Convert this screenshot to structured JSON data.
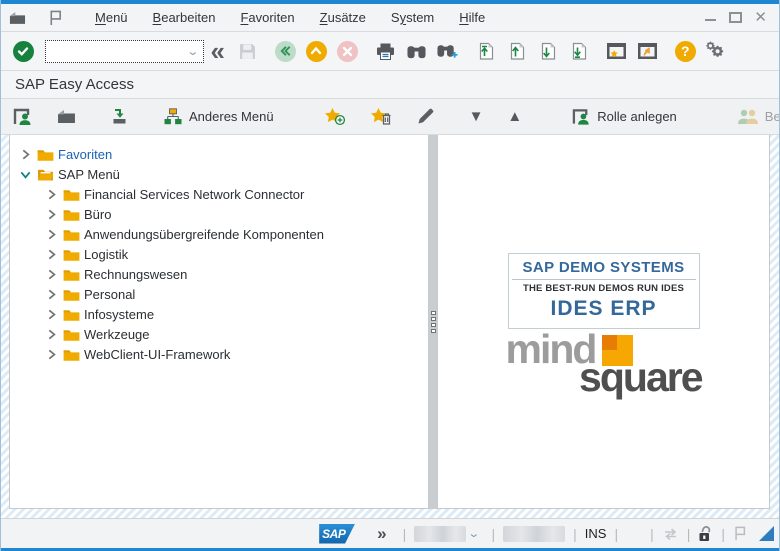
{
  "window": {
    "controls": [
      "minimize",
      "maximize",
      "close"
    ],
    "accent_color": "#1f86d2"
  },
  "titlebar": {
    "icons": [
      "sap-menu-box-icon",
      "gui-flag-icon"
    ],
    "menus": [
      {
        "label": "Menü",
        "underline_index": 0
      },
      {
        "label": "Bearbeiten",
        "underline_index": 0
      },
      {
        "label": "Favoriten",
        "underline_index": 0
      },
      {
        "label": "Zusätze",
        "underline_index": 0
      },
      {
        "label": "System",
        "underline_index": 1
      },
      {
        "label": "Hilfe",
        "underline_index": 0
      }
    ]
  },
  "toolbar": {
    "command_field": {
      "value": "",
      "placeholder": ""
    },
    "icons": [
      "enter-check-icon",
      "command-dropdown-icon",
      "collapse-chevrons-icon",
      "save-icon",
      "back-icon",
      "exit-icon",
      "cancel-icon",
      "print-icon",
      "find-icon",
      "find-next-icon",
      "first-page-icon",
      "page-up-icon",
      "page-down-icon",
      "last-page-icon",
      "new-session-icon",
      "create-shortcut-icon",
      "help-icon",
      "customize-layout-icon"
    ]
  },
  "header": {
    "title": "SAP Easy Access"
  },
  "app_toolbar": {
    "icons": [
      "user-menu-icon",
      "sap-menu-icon",
      "display-documentation-icon",
      "org-chart-icon",
      "add-favorite-icon",
      "delete-favorite-icon",
      "edit-favorite-icon",
      "move-down-icon",
      "move-up-icon",
      "create-role-icon",
      "assign-users-icon",
      "overflow-icon"
    ],
    "labels": {
      "anderes_menu": "Anderes Menü",
      "rolle_anlegen": "Rolle anlegen",
      "benutzer_zuordnen": "Benutzer zuordnen",
      "overflow": "»"
    },
    "benutzer_zuordnen_disabled": true
  },
  "tree": {
    "items": [
      {
        "label": "Favoriten",
        "level": 0,
        "state": "collapsed",
        "folder": "closed",
        "link": true
      },
      {
        "label": "SAP Menü",
        "level": 0,
        "state": "expanded",
        "folder": "open",
        "link": false
      },
      {
        "label": "Financial Services Network Connector",
        "level": 1,
        "state": "collapsed",
        "folder": "closed",
        "link": false
      },
      {
        "label": "Büro",
        "level": 1,
        "state": "collapsed",
        "folder": "closed",
        "link": false
      },
      {
        "label": "Anwendungsübergreifende Komponenten",
        "level": 1,
        "state": "collapsed",
        "folder": "closed",
        "link": false
      },
      {
        "label": "Logistik",
        "level": 1,
        "state": "collapsed",
        "folder": "closed",
        "link": false
      },
      {
        "label": "Rechnungswesen",
        "level": 1,
        "state": "collapsed",
        "folder": "closed",
        "link": false
      },
      {
        "label": "Personal",
        "level": 1,
        "state": "collapsed",
        "folder": "closed",
        "link": false
      },
      {
        "label": "Infosysteme",
        "level": 1,
        "state": "collapsed",
        "folder": "closed",
        "link": false
      },
      {
        "label": "Werkzeuge",
        "level": 1,
        "state": "collapsed",
        "folder": "closed",
        "link": false
      },
      {
        "label": "WebClient-UI-Framework",
        "level": 1,
        "state": "collapsed",
        "folder": "closed",
        "link": false
      }
    ],
    "folder_color": "#f0ab00",
    "favorites_link_color": "#1a63b5",
    "expanded_chevron_color": "#12808a"
  },
  "right_panel": {
    "demo_box": {
      "line1": "SAP DEMO SYSTEMS",
      "line2": "THE BEST-RUN DEMOS RUN IDES",
      "line3": "IDES ERP",
      "text_color": "#34689b"
    },
    "logo": {
      "word1": "mind",
      "word2": "square",
      "square_colors": [
        "#e87d05",
        "#f6a701"
      ]
    }
  },
  "statusbar": {
    "icons": [
      "sap-logo",
      "expand-chevrons-icon",
      "dropdown-chevron-icon",
      "performance-icon",
      "lock-open-icon",
      "gui-flag-icon",
      "resize-grip"
    ],
    "ins_indicator": "INS",
    "redacted_fields": 2
  }
}
